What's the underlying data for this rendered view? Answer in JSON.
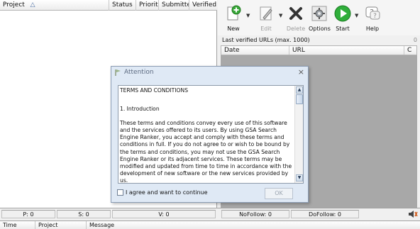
{
  "projects": {
    "columns": [
      {
        "label": "Project",
        "sort_icon": "△"
      },
      {
        "label": "Status"
      },
      {
        "label": "Priority"
      },
      {
        "label": "Submitted"
      },
      {
        "label": "Verified"
      }
    ]
  },
  "toolbar": {
    "new": "New",
    "edit": "Edit",
    "delete": "Delete",
    "options": "Options",
    "start": "Start",
    "help": "Help"
  },
  "urls": {
    "label": "Last verified URLs (max. 1000)",
    "count": "0",
    "columns": [
      "Date",
      "URL",
      "C"
    ]
  },
  "status": {
    "p": "P: 0",
    "s": "S: 0",
    "v": "V: 0",
    "nofollow": "NoFollow:  0",
    "dofollow": "DoFollow:  0"
  },
  "log": {
    "columns": [
      "Time",
      "Project",
      "Message"
    ]
  },
  "dialog": {
    "title": "Attention",
    "heading": "TERMS AND CONDITIONS",
    "section": "1. Introduction",
    "body": "These terms and conditions convey every use of this software and the services offered to its users. By using GSA Search Engine Ranker, you accept and comply with these terms and conditions in full. If you do not agree to or wish to be bound by the terms and conditions, you may not use the GSA Search Engine Ranker or its adjacent services. These terms may be modified and updated from time to time in accordance with the development of new software or the new services provided by us.",
    "agree_label": "I agree and want to continue",
    "ok_label": "OK",
    "agreed": false
  },
  "colors": {
    "new_icon": "#3aa83a",
    "start_icon": "#2fae3a",
    "delete_icon": "#333333"
  }
}
